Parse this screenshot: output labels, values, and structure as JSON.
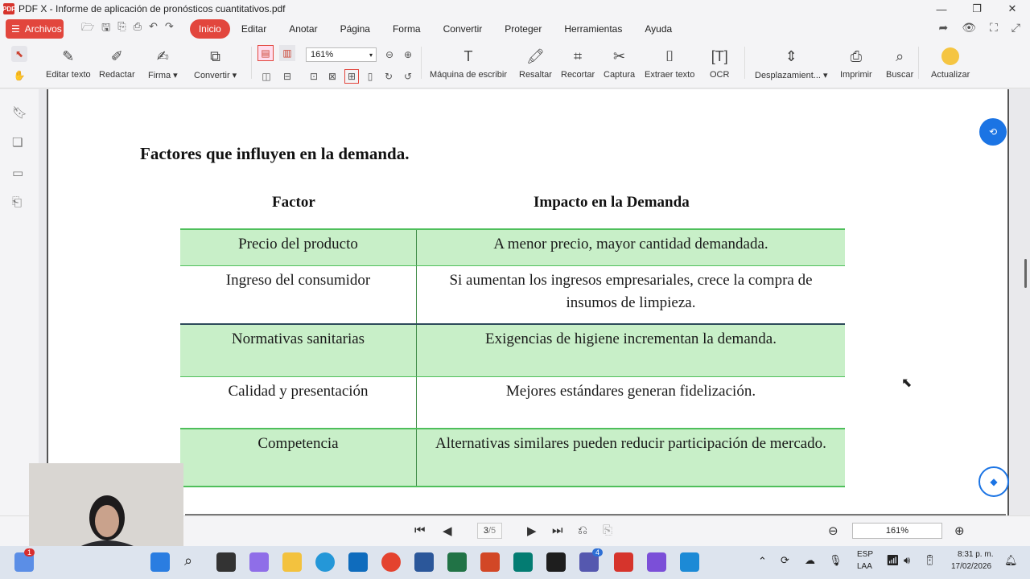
{
  "window": {
    "title": "PDF X - Informe de aplicación de pronósticos cuantitativos.pdf"
  },
  "menu": {
    "archivos": "Archivos",
    "items": [
      "Inicio",
      "Editar",
      "Anotar",
      "Página",
      "Forma",
      "Convertir",
      "Proteger",
      "Herramientas",
      "Ayuda"
    ]
  },
  "toolbar": {
    "zoom": "161%",
    "tools": [
      "Editar texto",
      "Redactar",
      "Firma",
      "Convertir",
      "Máquina de escribir",
      "Resaltar",
      "Recortar",
      "Captura",
      "Extraer texto",
      "OCR",
      "Desplazamient...",
      "Imprimir",
      "Buscar",
      "Actualizar"
    ]
  },
  "document": {
    "heading": "Factores que influyen en la demanda.",
    "columns": [
      "Factor",
      "Impacto en la Demanda"
    ],
    "rows": [
      {
        "factor": "Precio del producto",
        "impacto": "A menor precio, mayor cantidad demandada."
      },
      {
        "factor": "Ingreso del consumidor",
        "impacto": "Si aumentan los ingresos empresariales, crece la compra de insumos de limpieza."
      },
      {
        "factor": "Normativas sanitarias",
        "impacto": "Exigencias de higiene incrementan la demanda."
      },
      {
        "factor": "Calidad y presentación",
        "impacto": "Mejores estándares generan fidelización."
      },
      {
        "factor": "Competencia",
        "impacto": "Alternativas similares pueden reducir participación de mercado."
      }
    ]
  },
  "navigation": {
    "page_current": "3",
    "page_total": "/5",
    "zoom": "161%"
  },
  "taskbar": {
    "notification_badge": "1",
    "app_badge": "4",
    "lang": "ESP",
    "lang2": "LAA",
    "time": "8:31 p. m.",
    "date": "17/02/2026"
  },
  "colors": {
    "accent": "#e2463d",
    "row_green": "#c8efc8",
    "table_line": "#4fbf5b"
  }
}
